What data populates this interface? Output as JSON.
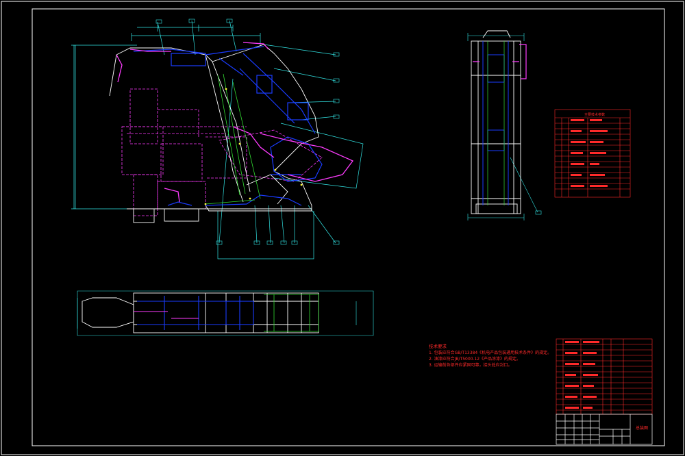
{
  "drawing": {
    "colors": {
      "background": "#000000",
      "frame": "#ffffff",
      "outline": "#ffffff",
      "blue": "#1a3cff",
      "magenta": "#ff3cff",
      "cyan": "#32e6e6",
      "green": "#32dc32",
      "red": "#ff2a2a",
      "yellow": "#ffff3c"
    },
    "notes": {
      "heading": "技术要求",
      "lines": [
        "1. 包装应符合GB/T13384《机电产品包装通用技术条件》的规定。",
        "2. 油漆应符合JB/T5000.12《产品涂漆》的规定。",
        "3. 运输前各部件应紧固可靠，接头处应封口。"
      ]
    },
    "table_title": "主要技术参数",
    "stamp_label": "总装图"
  }
}
